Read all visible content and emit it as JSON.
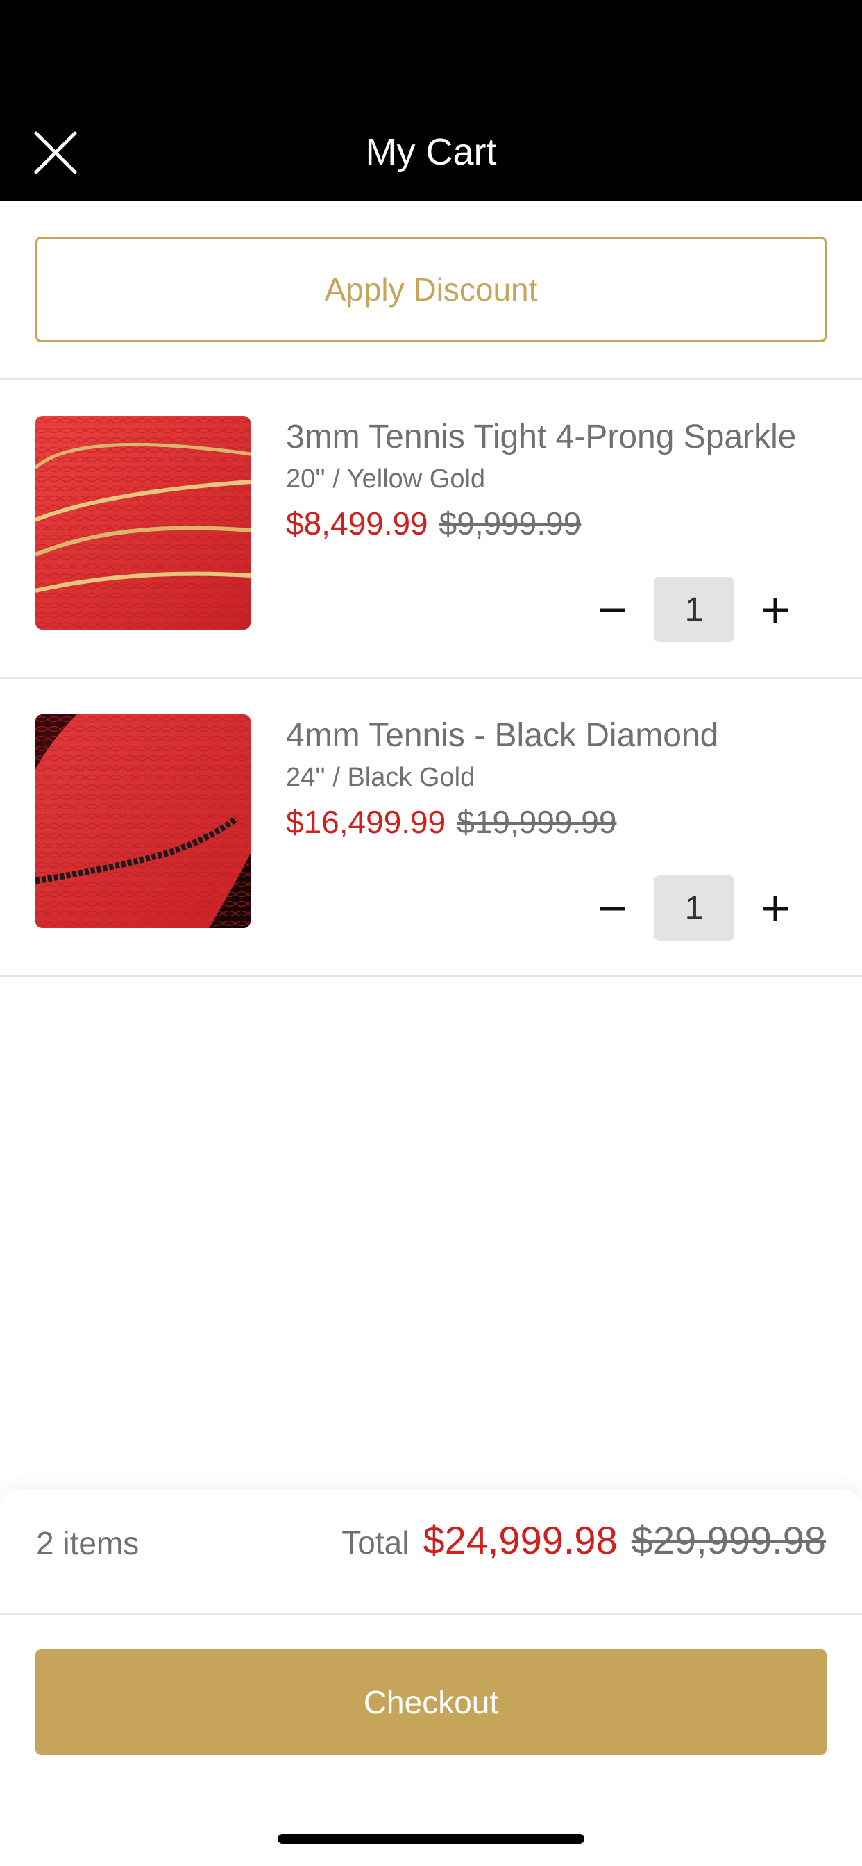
{
  "header": {
    "title": "My Cart"
  },
  "discount": {
    "label": "Apply Discount"
  },
  "cart_items": [
    {
      "title": "3mm Tennis Tight 4-Prong Sparkle",
      "variant": "20'' / Yellow Gold",
      "sale_price": "$8,499.99",
      "original_price": "$9,999.99",
      "quantity": "1",
      "image_icon": "gold-tennis-chain-image"
    },
    {
      "title": "4mm Tennis - Black Diamond",
      "variant": "24'' / Black Gold",
      "sale_price": "$16,499.99",
      "original_price": "$19,999.99",
      "quantity": "1",
      "image_icon": "black-diamond-chain-image"
    }
  ],
  "footer": {
    "items_count": "2 items",
    "total_label": "Total",
    "total_sale": "$24,999.98",
    "total_original": "$29,999.98",
    "checkout_label": "Checkout"
  },
  "colors": {
    "accent_gold": "#c6a55b",
    "sale_red": "#d0201e",
    "header_black": "#000000"
  }
}
